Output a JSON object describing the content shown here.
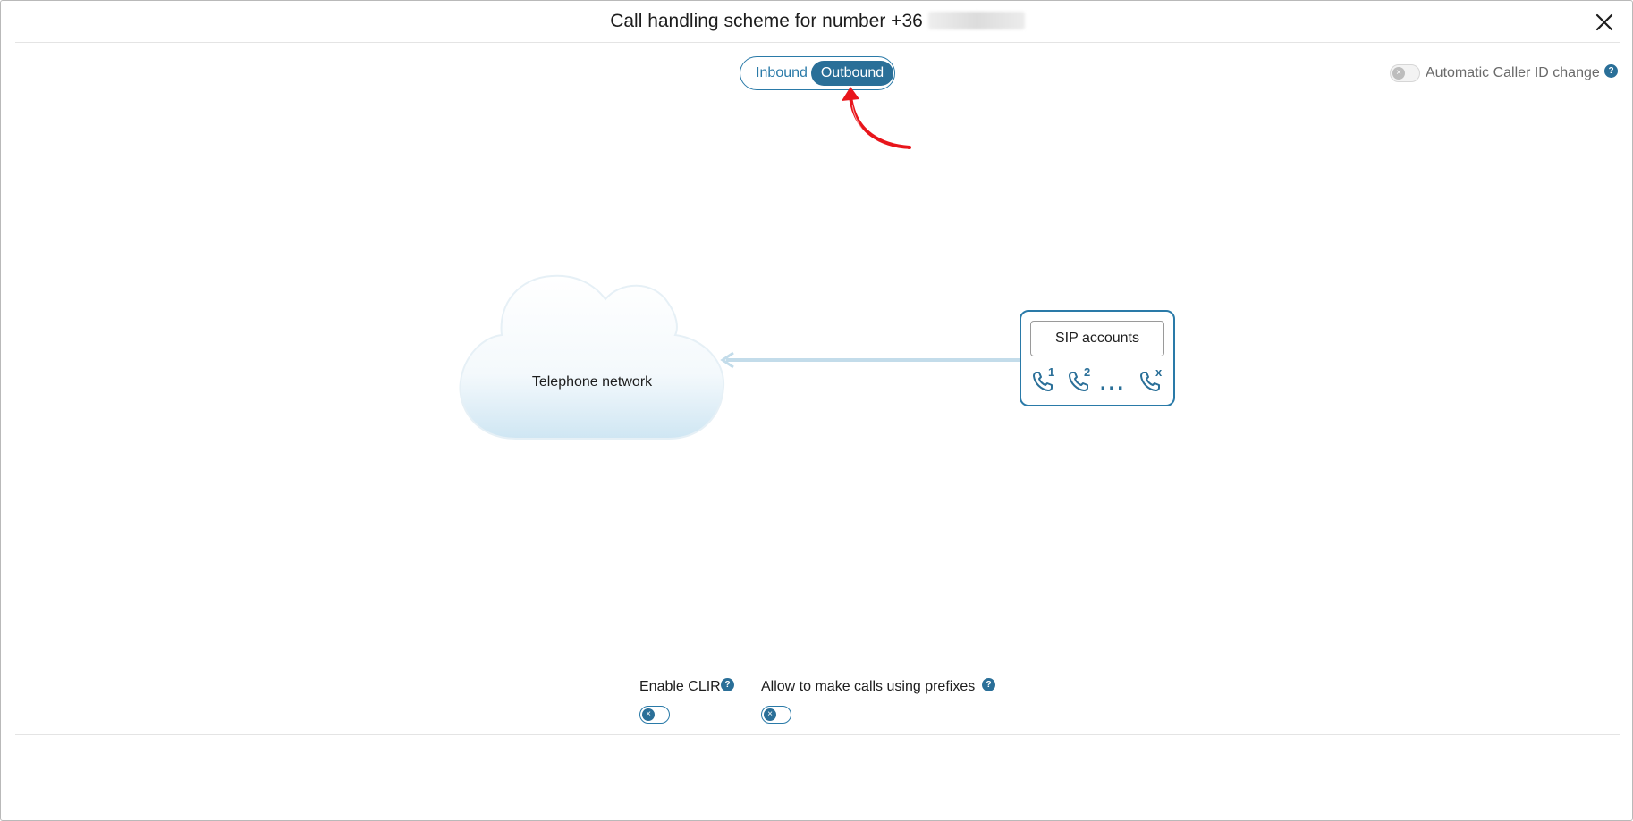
{
  "dialog": {
    "title": "Call handling scheme for number +36",
    "close_icon": "close-icon"
  },
  "direction_switch": {
    "options": [
      {
        "label": "Inbound",
        "selected": false
      },
      {
        "label": "Outbound",
        "selected": true
      }
    ]
  },
  "auto_caller_id": {
    "label": "Automatic Caller ID change",
    "enabled": false,
    "help": "?"
  },
  "diagram": {
    "network_label": "Telephone network",
    "sip_label": "SIP accounts",
    "sip_phones": [
      "1",
      "2",
      "x"
    ],
    "ellipsis": "..."
  },
  "options": [
    {
      "label": "Enable CLIR",
      "enabled": false,
      "help": "?"
    },
    {
      "label": "Allow to make calls using prefixes",
      "enabled": false,
      "help": "?"
    }
  ],
  "colors": {
    "accent": "#2a6f98",
    "accent_border": "#2a7aa8",
    "annotation_arrow": "#e8151b"
  }
}
